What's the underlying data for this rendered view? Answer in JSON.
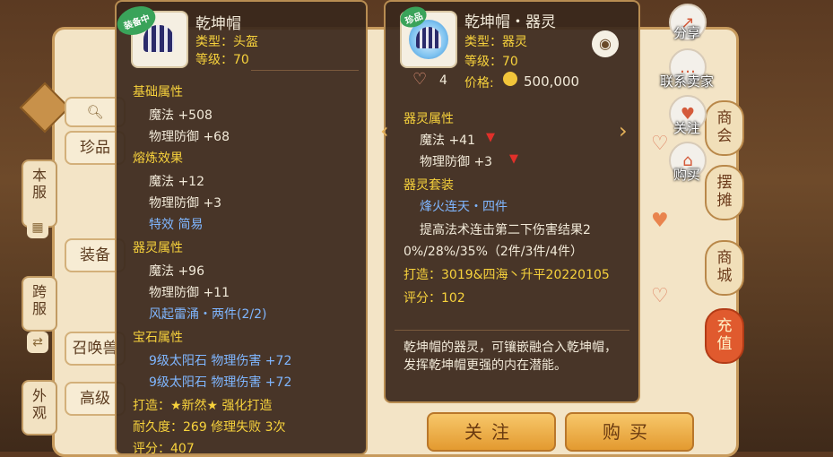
{
  "background": {
    "side_tabs": [
      "本服",
      "跨服",
      "外观"
    ],
    "side_icons": [
      "grid-icon",
      "swap-icon"
    ],
    "categories": [
      "珍品",
      "装备",
      "召唤兽",
      "高级"
    ],
    "right_tabs": [
      "商会",
      "摆摊",
      "商城",
      "充值"
    ],
    "actions": [
      {
        "icon": "share-icon",
        "label": "分享"
      },
      {
        "icon": "chat-icon",
        "label": "联系卖家"
      },
      {
        "icon": "heart-icon",
        "label": "关注"
      },
      {
        "icon": "cart-icon",
        "label": "购买"
      }
    ],
    "bottom_buttons": [
      "关注",
      "购买"
    ]
  },
  "left_card": {
    "badge": "装备中",
    "name": "乾坤帽",
    "type": "类型：头盔",
    "level": "等级：70",
    "sections": [
      {
        "title": "基础属性",
        "lines": [
          "魔法 +508",
          "物理防御 +68"
        ]
      },
      {
        "title": "熔炼效果",
        "lines": [
          "魔法 +12",
          "物理防御 +3"
        ],
        "extra": "特效 简易"
      },
      {
        "title": "器灵属性",
        "lines": [
          "魔法 +96",
          "物理防御 +11"
        ],
        "extra": "风起雷涌・两件(2/2)"
      },
      {
        "title": "宝石属性",
        "extras": [
          "9级太阳石 物理伤害 +72",
          "9级太阳石 物理伤害 +72"
        ]
      }
    ],
    "forge": "打造：★新然★  强化打造",
    "durability": "耐久度：269 修理失败 3次",
    "score": "评分：407"
  },
  "right_card": {
    "badge": "珍品",
    "name": "乾坤帽・器灵",
    "type": "类型：器灵",
    "level": "等级：70",
    "likes": "4",
    "price_label": "价格:",
    "price": "500,000",
    "spirit_title": "器灵属性",
    "spirit_lines": [
      "魔法 +41",
      "物理防御 +3"
    ],
    "set_title": "器灵套装",
    "set_name": "烽火连天・四件",
    "set_desc_1": "提高法术连击第二下伤害结果2",
    "set_desc_2": "0%/28%/35%（2件/3件/4件）",
    "forge": "打造：3019&四海丶升平20220105",
    "score": "评分：102",
    "description": "乾坤帽的器灵，可镶嵌融合入乾坤帽，发挥乾坤帽更强的内在潜能。"
  },
  "colors": {
    "card_bg": "#3a281c",
    "yellow": "#f7d23c",
    "blue": "#7fb6ff",
    "red_arrow": "#e0302a"
  }
}
